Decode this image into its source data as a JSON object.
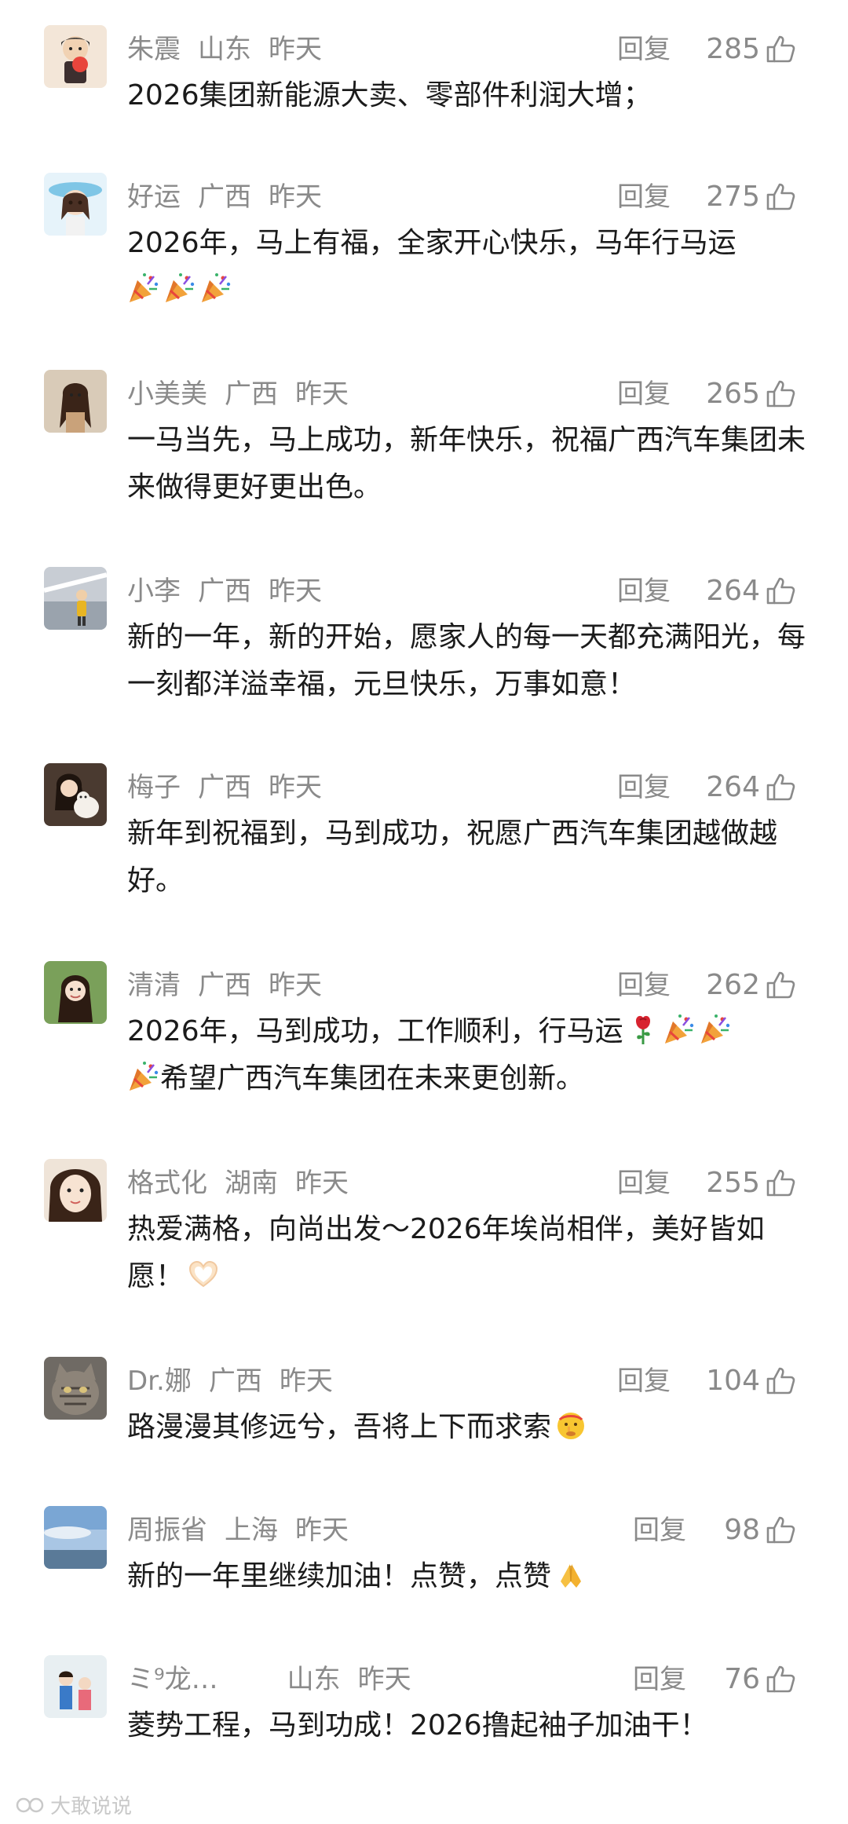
{
  "comments": [
    {
      "username": "朱震",
      "location": "山东",
      "time": "昨天",
      "reply_label": "回复",
      "likes": "285",
      "text": "2026集团新能源大卖、零部件利润大增；"
    },
    {
      "username": "好运",
      "location": "广西",
      "time": "昨天",
      "reply_label": "回复",
      "likes": "275",
      "text": "2026年，马上有福，全家开心快乐，马年行马运"
    },
    {
      "username": "小美美",
      "location": "广西",
      "time": "昨天",
      "reply_label": "回复",
      "likes": "265",
      "text": "一马当先，马上成功，新年快乐，祝福广西汽车集团未来做得更好更出色。"
    },
    {
      "username": "小李",
      "location": "广西",
      "time": "昨天",
      "reply_label": "回复",
      "likes": "264",
      "text": "新的一年，新的开始，愿家人的每一天都充满阳光，每一刻都洋溢幸福，元旦快乐，万事如意！"
    },
    {
      "username": "梅子",
      "location": "广西",
      "time": "昨天",
      "reply_label": "回复",
      "likes": "264",
      "text": "新年到祝福到，马到成功，祝愿广西汽车集团越做越好。"
    },
    {
      "username": "清清",
      "location": "广西",
      "time": "昨天",
      "reply_label": "回复",
      "likes": "262",
      "text": "2026年，马到成功，工作顺利，行马运",
      "text2": "希望广西汽车集团在未来更创新。"
    },
    {
      "username": "格式化",
      "location": "湖南",
      "time": "昨天",
      "reply_label": "回复",
      "likes": "255",
      "text": "热爱满格，向尚出发～2026年埃尚相伴，美好皆如愿！"
    },
    {
      "username": "Dr.娜",
      "location": "广西",
      "time": "昨天",
      "reply_label": "回复",
      "likes": "104",
      "text": "路漫漫其修远兮，吾将上下而求索"
    },
    {
      "username": "周振省",
      "location": "上海",
      "time": "昨天",
      "reply_label": "回复",
      "likes": "98",
      "text": "新的一年里继续加油！点赞，点赞"
    },
    {
      "username": "ミ⁹龙…",
      "location": "山东",
      "time": "昨天",
      "reply_label": "回复",
      "likes": "76",
      "text": "菱势工程，马到功成！2026撸起袖子加油干！"
    }
  ],
  "watermark": "大敢说说",
  "icons": {
    "like": "thumbs-up-icon",
    "party": "party-popper-icon",
    "rose": "rose-icon",
    "heart_hands": "heart-hands-icon",
    "shush": "shushing-face-icon",
    "pray": "praying-hands-icon"
  },
  "colors": {
    "meta_text": "#8a8a8a",
    "body_text": "#1b1b1b",
    "background": "#ffffff"
  }
}
